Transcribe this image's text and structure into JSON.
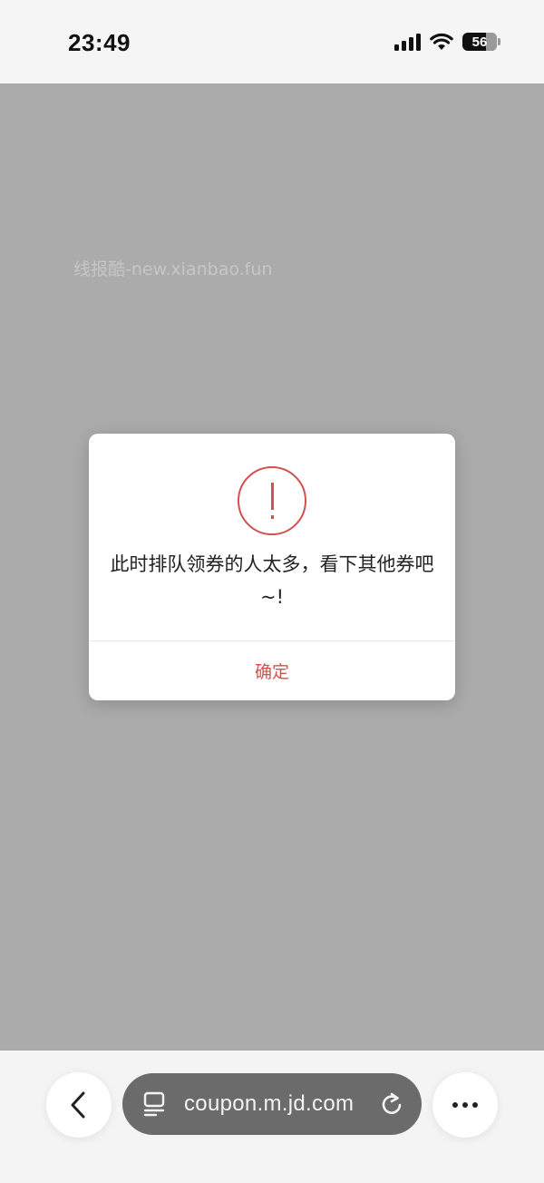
{
  "status_bar": {
    "time": "23:49",
    "battery_level": "56",
    "icons": [
      "signal-icon",
      "wifi-icon",
      "battery-icon"
    ]
  },
  "page": {
    "watermark": "线报酷-new.xianbao.fun"
  },
  "dialog": {
    "icon": "alert-circle-icon",
    "message": "此时排队领券的人太多，看下其他券吧~!",
    "confirm_label": "确定",
    "accent_color": "#d1514f"
  },
  "browser_bar": {
    "url": "coupon.m.jd.com",
    "icons": [
      "back-chevron-icon",
      "reader-icon",
      "reload-icon",
      "more-icon"
    ]
  }
}
